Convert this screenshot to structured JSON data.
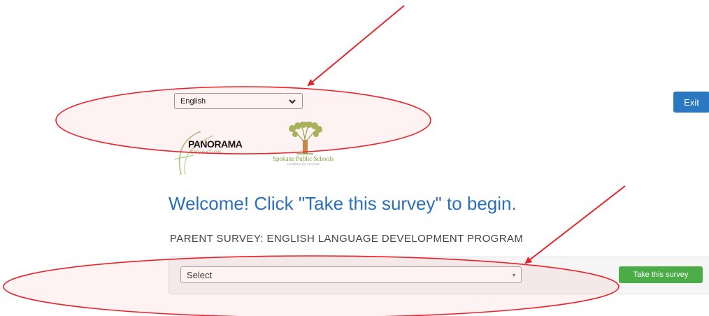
{
  "language_select": {
    "value": "English"
  },
  "exit_button": {
    "label": "Exit"
  },
  "logos": {
    "panorama": {
      "text": "PANORAMA",
      "sub": "EDUCATION"
    },
    "spokane": {
      "text": "Spokane Public Schools",
      "tagline": "excellence for everyone"
    }
  },
  "welcome": {
    "heading": "Welcome! Click \"Take this survey\" to begin."
  },
  "survey": {
    "name": "PARENT SURVEY: ENGLISH LANGUAGE DEVELOPMENT PROGRAM",
    "select_value": "Select",
    "take_button": "Take this survey"
  },
  "annotations": {
    "color": "#e8232b"
  },
  "colors": {
    "exit_button": "#2a78c2",
    "take_button": "#4bac48",
    "heading": "#2c6fb7"
  }
}
